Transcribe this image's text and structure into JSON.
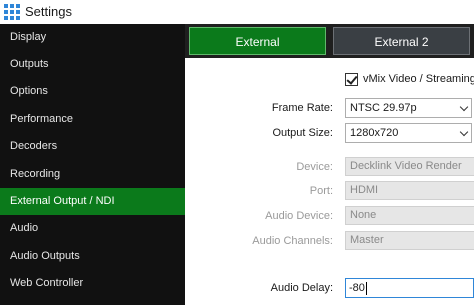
{
  "window": {
    "title": "Settings"
  },
  "sidebar": {
    "items": [
      {
        "label": "Display"
      },
      {
        "label": "Outputs"
      },
      {
        "label": "Options"
      },
      {
        "label": "Performance"
      },
      {
        "label": "Decoders"
      },
      {
        "label": "Recording"
      },
      {
        "label": "External Output / NDI",
        "active": true
      },
      {
        "label": "Audio"
      },
      {
        "label": "Audio Outputs"
      },
      {
        "label": "Web Controller"
      }
    ]
  },
  "tabs": [
    {
      "label": "External",
      "active": true
    },
    {
      "label": "External 2",
      "active": false
    }
  ],
  "form": {
    "vmix_checkbox": {
      "label": "vMix Video / Streaming",
      "checked": true
    },
    "frame_rate": {
      "label": "Frame Rate:",
      "value": "NTSC 29.97p"
    },
    "output_size": {
      "label": "Output Size:",
      "value": "1280x720"
    },
    "device": {
      "label": "Device:",
      "value": "Decklink Video Render"
    },
    "port": {
      "label": "Port:",
      "value": "HDMI"
    },
    "audio_device": {
      "label": "Audio Device:",
      "value": "None"
    },
    "audio_channels": {
      "label": "Audio Channels:",
      "value": "Master"
    },
    "audio_delay": {
      "label": "Audio Delay:",
      "value": "-80"
    }
  },
  "colors": {
    "accent_green": "#0b7a1b",
    "sidebar_bg": "#111111",
    "tab_inactive": "#3a3f44",
    "focus_blue": "#2f86d8"
  },
  "icons": {
    "app": "vmix-grid-icon"
  }
}
